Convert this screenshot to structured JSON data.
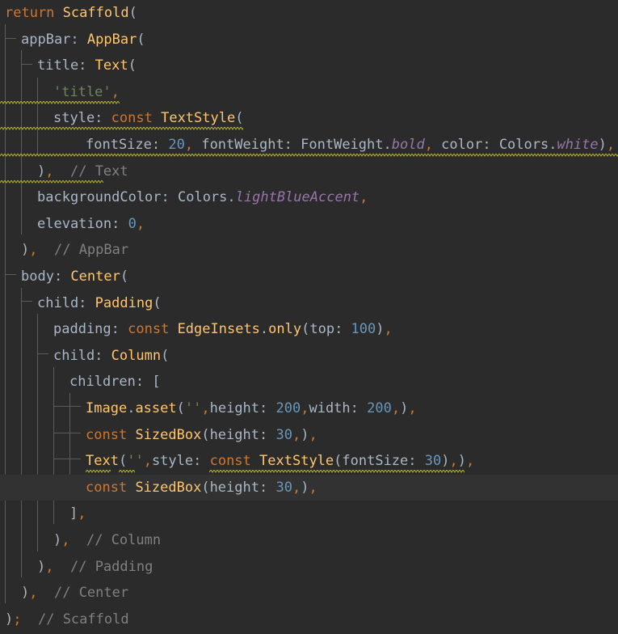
{
  "editor": {
    "language": "dart",
    "colors": {
      "background": "#2b2b2b",
      "current_line": "#323232",
      "keyword": "#cc7832",
      "function": "#ffc66d",
      "string": "#6a8759",
      "number": "#6897bb",
      "comment": "#808080",
      "constant": "#9876aa",
      "default": "#a9b7c6",
      "warning_squiggle": "#bbb529"
    },
    "lines": [
      {
        "tokens": [
          {
            "t": "return",
            "c": "kw"
          },
          {
            "t": " "
          },
          {
            "t": "Scaffold",
            "c": "fn"
          },
          {
            "t": "("
          }
        ]
      },
      {
        "tokens": [
          {
            "t": "appBar: "
          },
          {
            "t": "AppBar",
            "c": "fn"
          },
          {
            "t": "("
          }
        ]
      },
      {
        "tokens": [
          {
            "t": "title: "
          },
          {
            "t": "Text",
            "c": "fn"
          },
          {
            "t": "("
          }
        ]
      },
      {
        "tokens": [
          {
            "t": "'title'",
            "c": "str"
          },
          {
            "t": ",",
            "c": "kw"
          }
        ]
      },
      {
        "tokens": [
          {
            "t": "style: "
          },
          {
            "t": "const",
            "c": "kw"
          },
          {
            "t": " "
          },
          {
            "t": "TextStyle",
            "c": "fn"
          },
          {
            "t": "("
          }
        ]
      },
      {
        "tokens": [
          {
            "t": "fontSize: "
          },
          {
            "t": "20",
            "c": "num"
          },
          {
            "t": ",",
            "c": "kw"
          },
          {
            "t": " fontWeight: FontWeight."
          },
          {
            "t": "bold",
            "c": "cst"
          },
          {
            "t": ",",
            "c": "kw"
          },
          {
            "t": " color: Colors."
          },
          {
            "t": "white",
            "c": "cst"
          },
          {
            "t": ")"
          },
          {
            "t": ",",
            "c": "kw"
          }
        ]
      },
      {
        "tokens": [
          {
            "t": ")"
          },
          {
            "t": ",",
            "c": "kw"
          },
          {
            "t": "  "
          },
          {
            "t": "// Text",
            "c": "cmt"
          }
        ]
      },
      {
        "tokens": [
          {
            "t": "backgroundColor: Colors."
          },
          {
            "t": "lightBlueAccent",
            "c": "cst"
          },
          {
            "t": ",",
            "c": "kw"
          }
        ]
      },
      {
        "tokens": [
          {
            "t": "elevation: "
          },
          {
            "t": "0",
            "c": "num"
          },
          {
            "t": ",",
            "c": "kw"
          }
        ]
      },
      {
        "tokens": [
          {
            "t": ")"
          },
          {
            "t": ",",
            "c": "kw"
          },
          {
            "t": "  "
          },
          {
            "t": "// AppBar",
            "c": "cmt"
          }
        ]
      },
      {
        "tokens": [
          {
            "t": "body: "
          },
          {
            "t": "Center",
            "c": "fn"
          },
          {
            "t": "("
          }
        ]
      },
      {
        "tokens": [
          {
            "t": "child: "
          },
          {
            "t": "Padding",
            "c": "fn"
          },
          {
            "t": "("
          }
        ]
      },
      {
        "tokens": [
          {
            "t": "padding: "
          },
          {
            "t": "const",
            "c": "kw"
          },
          {
            "t": " "
          },
          {
            "t": "EdgeInsets",
            "c": "fn"
          },
          {
            "t": "."
          },
          {
            "t": "only",
            "c": "fn"
          },
          {
            "t": "(top: "
          },
          {
            "t": "100",
            "c": "num"
          },
          {
            "t": ")"
          },
          {
            "t": ",",
            "c": "kw"
          }
        ]
      },
      {
        "tokens": [
          {
            "t": "child: "
          },
          {
            "t": "Column",
            "c": "fn"
          },
          {
            "t": "("
          }
        ]
      },
      {
        "tokens": [
          {
            "t": "children: ["
          }
        ]
      },
      {
        "tokens": [
          {
            "t": "Image",
            "c": "fn"
          },
          {
            "t": "."
          },
          {
            "t": "asset",
            "c": "fn"
          },
          {
            "t": "("
          },
          {
            "t": "''",
            "c": "str"
          },
          {
            "t": ",",
            "c": "kw"
          },
          {
            "t": "height: "
          },
          {
            "t": "200",
            "c": "num"
          },
          {
            "t": ",",
            "c": "kw"
          },
          {
            "t": "width: "
          },
          {
            "t": "200",
            "c": "num"
          },
          {
            "t": ",",
            "c": "kw"
          },
          {
            "t": ")"
          },
          {
            "t": ",",
            "c": "kw"
          }
        ]
      },
      {
        "tokens": [
          {
            "t": "const",
            "c": "kw"
          },
          {
            "t": " "
          },
          {
            "t": "SizedBox",
            "c": "fn"
          },
          {
            "t": "(height: "
          },
          {
            "t": "30",
            "c": "num"
          },
          {
            "t": ",",
            "c": "kw"
          },
          {
            "t": ")"
          },
          {
            "t": ",",
            "c": "kw"
          }
        ]
      },
      {
        "tokens": [
          {
            "t": "Text",
            "c": "fn"
          },
          {
            "t": "("
          },
          {
            "t": "''",
            "c": "str"
          },
          {
            "t": ",",
            "c": "kw"
          },
          {
            "t": "style: "
          },
          {
            "t": "const",
            "c": "kw"
          },
          {
            "t": " "
          },
          {
            "t": "TextStyle",
            "c": "fn"
          },
          {
            "t": "(fontSize: "
          },
          {
            "t": "30",
            "c": "num"
          },
          {
            "t": ")"
          },
          {
            "t": ",",
            "c": "kw"
          },
          {
            "t": ")"
          },
          {
            "t": ",",
            "c": "kw"
          }
        ]
      },
      {
        "tokens": [
          {
            "t": "const",
            "c": "kw"
          },
          {
            "t": " "
          },
          {
            "t": "SizedBox",
            "c": "fn"
          },
          {
            "t": "(height: "
          },
          {
            "t": "30",
            "c": "num"
          },
          {
            "t": ",",
            "c": "kw"
          },
          {
            "t": ")"
          },
          {
            "t": ",",
            "c": "kw"
          }
        ]
      },
      {
        "tokens": [
          {
            "t": "]"
          },
          {
            "t": ",",
            "c": "kw"
          }
        ]
      },
      {
        "tokens": [
          {
            "t": ")"
          },
          {
            "t": ",",
            "c": "kw"
          },
          {
            "t": "  "
          },
          {
            "t": "// Column",
            "c": "cmt"
          }
        ]
      },
      {
        "tokens": [
          {
            "t": ")"
          },
          {
            "t": ",",
            "c": "kw"
          },
          {
            "t": "  "
          },
          {
            "t": "// Padding",
            "c": "cmt"
          }
        ]
      },
      {
        "tokens": [
          {
            "t": ")"
          },
          {
            "t": ",",
            "c": "kw"
          },
          {
            "t": "  "
          },
          {
            "t": "// Center",
            "c": "cmt"
          }
        ]
      },
      {
        "tokens": [
          {
            "t": ")"
          },
          {
            "t": ";",
            "c": "kw"
          },
          {
            "t": "  "
          },
          {
            "t": "// Scaffold",
            "c": "cmt"
          }
        ]
      }
    ]
  }
}
